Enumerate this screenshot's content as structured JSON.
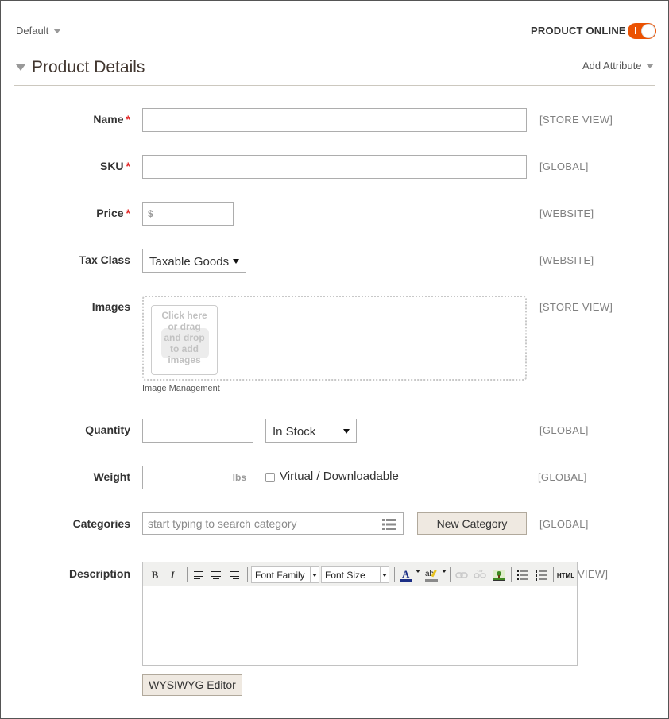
{
  "header": {
    "store_switcher": "Default",
    "product_online_label": "PRODUCT ONLINE",
    "product_online_enabled": true
  },
  "section": {
    "title": "Product Details",
    "add_attribute": "Add Attribute"
  },
  "fields": {
    "name": {
      "label": "Name",
      "required": "*",
      "value": "",
      "scope": "[STORE VIEW]"
    },
    "sku": {
      "label": "SKU",
      "required": "*",
      "value": "",
      "scope": "[GLOBAL]"
    },
    "price": {
      "label": "Price",
      "required": "*",
      "currency": "$",
      "value": "",
      "scope": "[WEBSITE]"
    },
    "tax_class": {
      "label": "Tax Class",
      "selected": "Taxable Goods",
      "scope": "[WEBSITE]"
    },
    "images": {
      "label": "Images",
      "upload_text": [
        "Click here",
        "or drag",
        "and drop",
        "to add",
        "images"
      ],
      "management_link": "Image Management",
      "scope": "[STORE VIEW]"
    },
    "quantity": {
      "label": "Quantity",
      "value": "",
      "stock_status": "In Stock",
      "scope": "[GLOBAL]"
    },
    "weight": {
      "label": "Weight",
      "unit": "lbs",
      "value": "",
      "virtual_label": "Virtual / Downloadable",
      "virtual_checked": false,
      "scope": "[GLOBAL]"
    },
    "categories": {
      "label": "Categories",
      "placeholder": "start typing to search category",
      "new_button": "New Category",
      "scope": "[GLOBAL]"
    },
    "description": {
      "label": "Description",
      "scope_partial": "VIEW]",
      "font_family": "Font Family",
      "font_size": "Font Size",
      "bold": "B",
      "italic": "I",
      "html_btn": "HTML",
      "wysiwyg_button": "WYSIWYG Editor"
    }
  },
  "colors": {
    "accent": "#eb5202",
    "required": "#e22626",
    "button_bg": "#efe9e1",
    "scope_text": "#808080"
  }
}
